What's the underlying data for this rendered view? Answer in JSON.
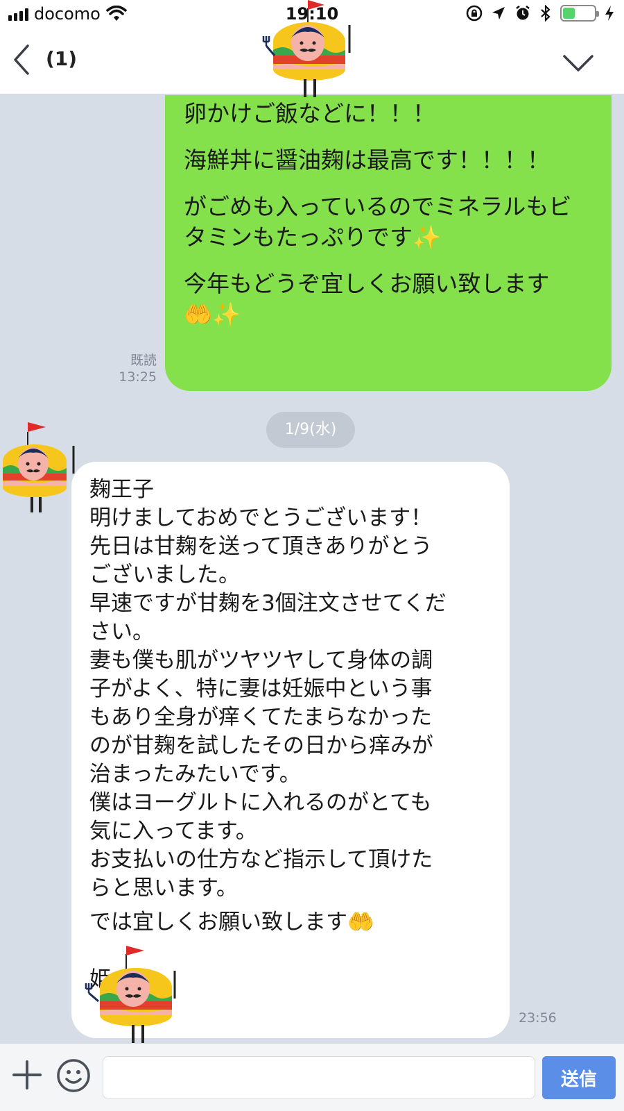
{
  "status_bar": {
    "carrier": "docomo",
    "time": "19:10"
  },
  "header": {
    "title": "(1)"
  },
  "messages": {
    "outgoing": {
      "paragraphs": [
        "卵かけご飯などに！！！",
        "海鮮丼に醤油麹は最高です！！！！",
        "がごめも入っているのでミネラルもビ\nタミンもたっぷりです✨",
        "今年もどうぞ宜しくお願い致します\n🤲✨"
      ],
      "read_label": "既読",
      "time": "13:25"
    },
    "date_separator": "1/9(水)",
    "incoming": {
      "text": "麹王子\n明けましておめでとうございます！\n先日は甘麹を送って頂きありがとう\nございました。\n早速ですが甘麹を3個注文させてくだ\nさい。\n妻も僕も肌がツヤツヤして身体の調\n子がよく、特に妻は妊娠中という事\nもあり全身が痒くてたまらなかった\nのが甘麹を試したその日から痒みが\n治まったみたいです。\n僕はヨーグルトに入れるのがとても\n気に入ってます。\nお支払いの仕方など指示して頂けた\nらと思います。",
      "closing": "では宜しくお願い致します🤲",
      "signature": "姫",
      "time": "23:56"
    }
  },
  "footer": {
    "input_placeholder": "",
    "send_label": "送信"
  },
  "colors": {
    "outgoing_bubble": "#84e04b",
    "incoming_bubble": "#ffffff",
    "chat_background": "#d7dde6",
    "send_button": "#5b8ee6"
  }
}
